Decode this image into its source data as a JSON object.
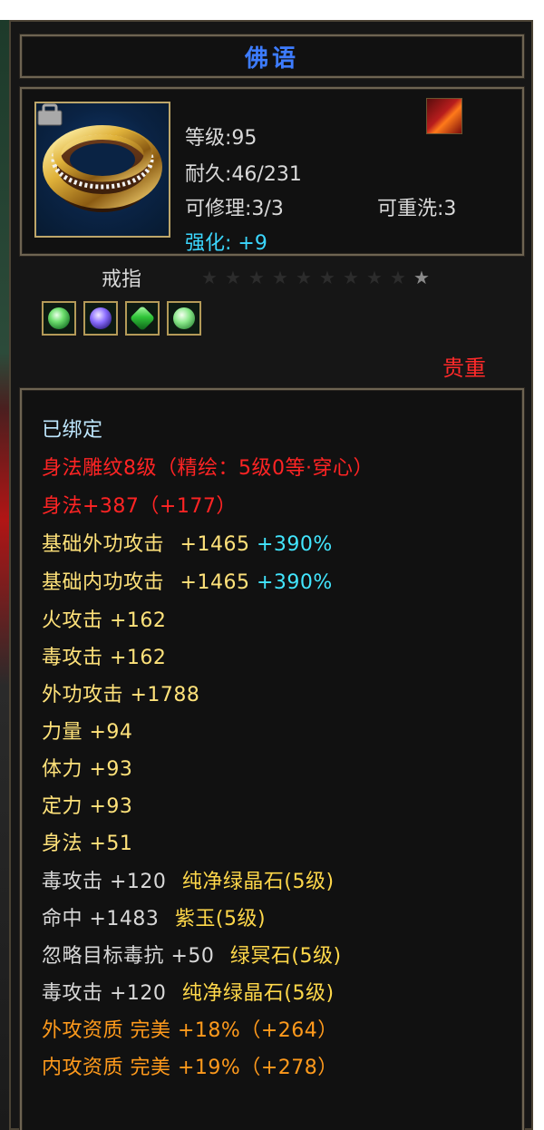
{
  "item": {
    "title": "佛语",
    "level": "等级:95",
    "durability": "耐久:46/231",
    "repair": "可修理:3/3",
    "rewash": "可重洗:3",
    "enhance_label": "强化:",
    "enhance_value": "+9",
    "name": "戒指",
    "rarity": "贵重",
    "stars_total": 10,
    "stars_filled": 0,
    "gems": [
      "green-gem",
      "purple-gem",
      "emerald-gem",
      "jade-gem"
    ]
  },
  "stats": {
    "bound": "已绑定",
    "engrave": "身法雕纹8级（精绘：5级0等·穿心）",
    "agility_engrave": "身法+387（+177）",
    "base_ext_atk_label": "基础外功攻击",
    "base_ext_atk_value": "+1465",
    "base_ext_atk_pct": "+390%",
    "base_int_atk_label": "基础内功攻击",
    "base_int_atk_value": "+1465",
    "base_int_atk_pct": "+390%",
    "fire_atk": "火攻击 +162",
    "poison_atk": "毒攻击 +162",
    "ext_atk": "外功攻击 +1788",
    "strength": "力量 +94",
    "stamina": "体力 +93",
    "focus": "定力 +93",
    "agility": "身法 +51",
    "gem1_stat": "毒攻击 +120",
    "gem1_name": "纯净绿晶石(5级)",
    "gem2_stat": "命中 +1483",
    "gem2_name": "紫玉(5级)",
    "gem3_stat": "忽略目标毒抗 +50",
    "gem3_name": "绿冥石(5级)",
    "gem4_stat": "毒攻击 +120",
    "gem4_name": "纯净绿晶石(5级)",
    "ext_quality": "外攻资质  完美 +18%（+264）",
    "int_quality": "内攻资质  完美 +19%（+278）"
  },
  "colors": {
    "title": "#3d7cff",
    "rarity": "#ff2a2a",
    "engrave": "#ff2424",
    "stat": "#ffe27a",
    "percent": "#42e6ff",
    "quality": "#ff9a1c"
  }
}
